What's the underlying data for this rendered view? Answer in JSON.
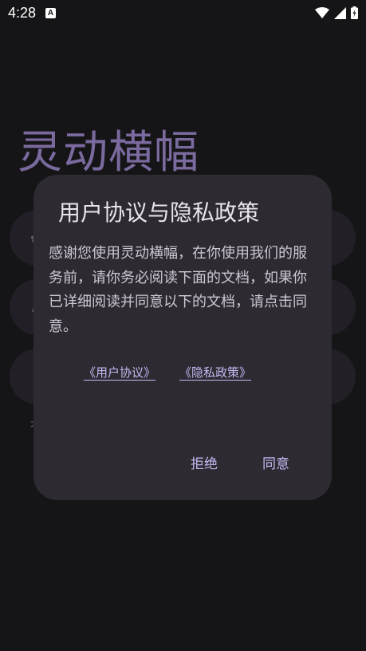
{
  "status_bar": {
    "time": "4:28",
    "notification_badge": "A",
    "icons": [
      "wifi-icon",
      "signal-icon",
      "battery-charging-icon"
    ]
  },
  "background": {
    "app_title": "灵动横幅",
    "card_glyphs": [
      "✿",
      "∧",
      "⌄"
    ],
    "small_text": "ㅊ"
  },
  "dialog": {
    "title": "用户协议与隐私政策",
    "message": "感谢您使用灵动横幅，在你使用我们的服务前，请你务必阅读下面的文档，如果你已详细阅读并同意以下的文档，请点击同意。",
    "links": {
      "user_agreement": "《用户协议》",
      "privacy_policy": "《隐私政策》"
    },
    "buttons": {
      "reject": "拒绝",
      "agree": "同意"
    }
  },
  "colors": {
    "background": "#151416",
    "dialog_surface": "#2d2a32",
    "accent": "#c7b8f2",
    "title_purple": "#7a6a9e"
  }
}
